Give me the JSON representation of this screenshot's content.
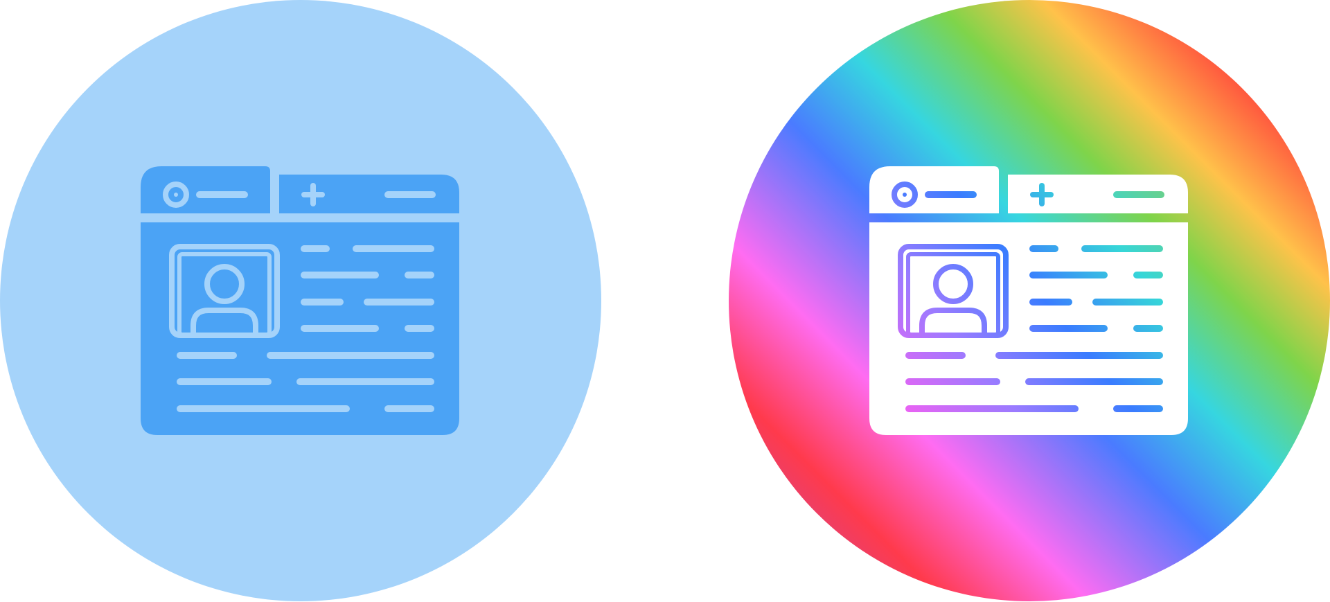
{
  "icons": [
    {
      "name": "profile-page-icon",
      "style": "glyph",
      "background": "#a5d3fa",
      "foreground": "#4ba3f5",
      "line_color": "#a5d3fa"
    },
    {
      "name": "profile-page-icon",
      "style": "gradient",
      "background_gradient": [
        "#a84fc8",
        "#ff3a4c",
        "#ff6cf2",
        "#4a7bff",
        "#36d6e0",
        "#7fd44a",
        "#ffc24a",
        "#ff3b3b",
        "#ffffff"
      ],
      "foreground": "#ffffff",
      "line_gradient": [
        "#ff5cf0",
        "#9a7bff",
        "#3a7cff",
        "#36d6d8",
        "#6ad08a"
      ]
    }
  ]
}
